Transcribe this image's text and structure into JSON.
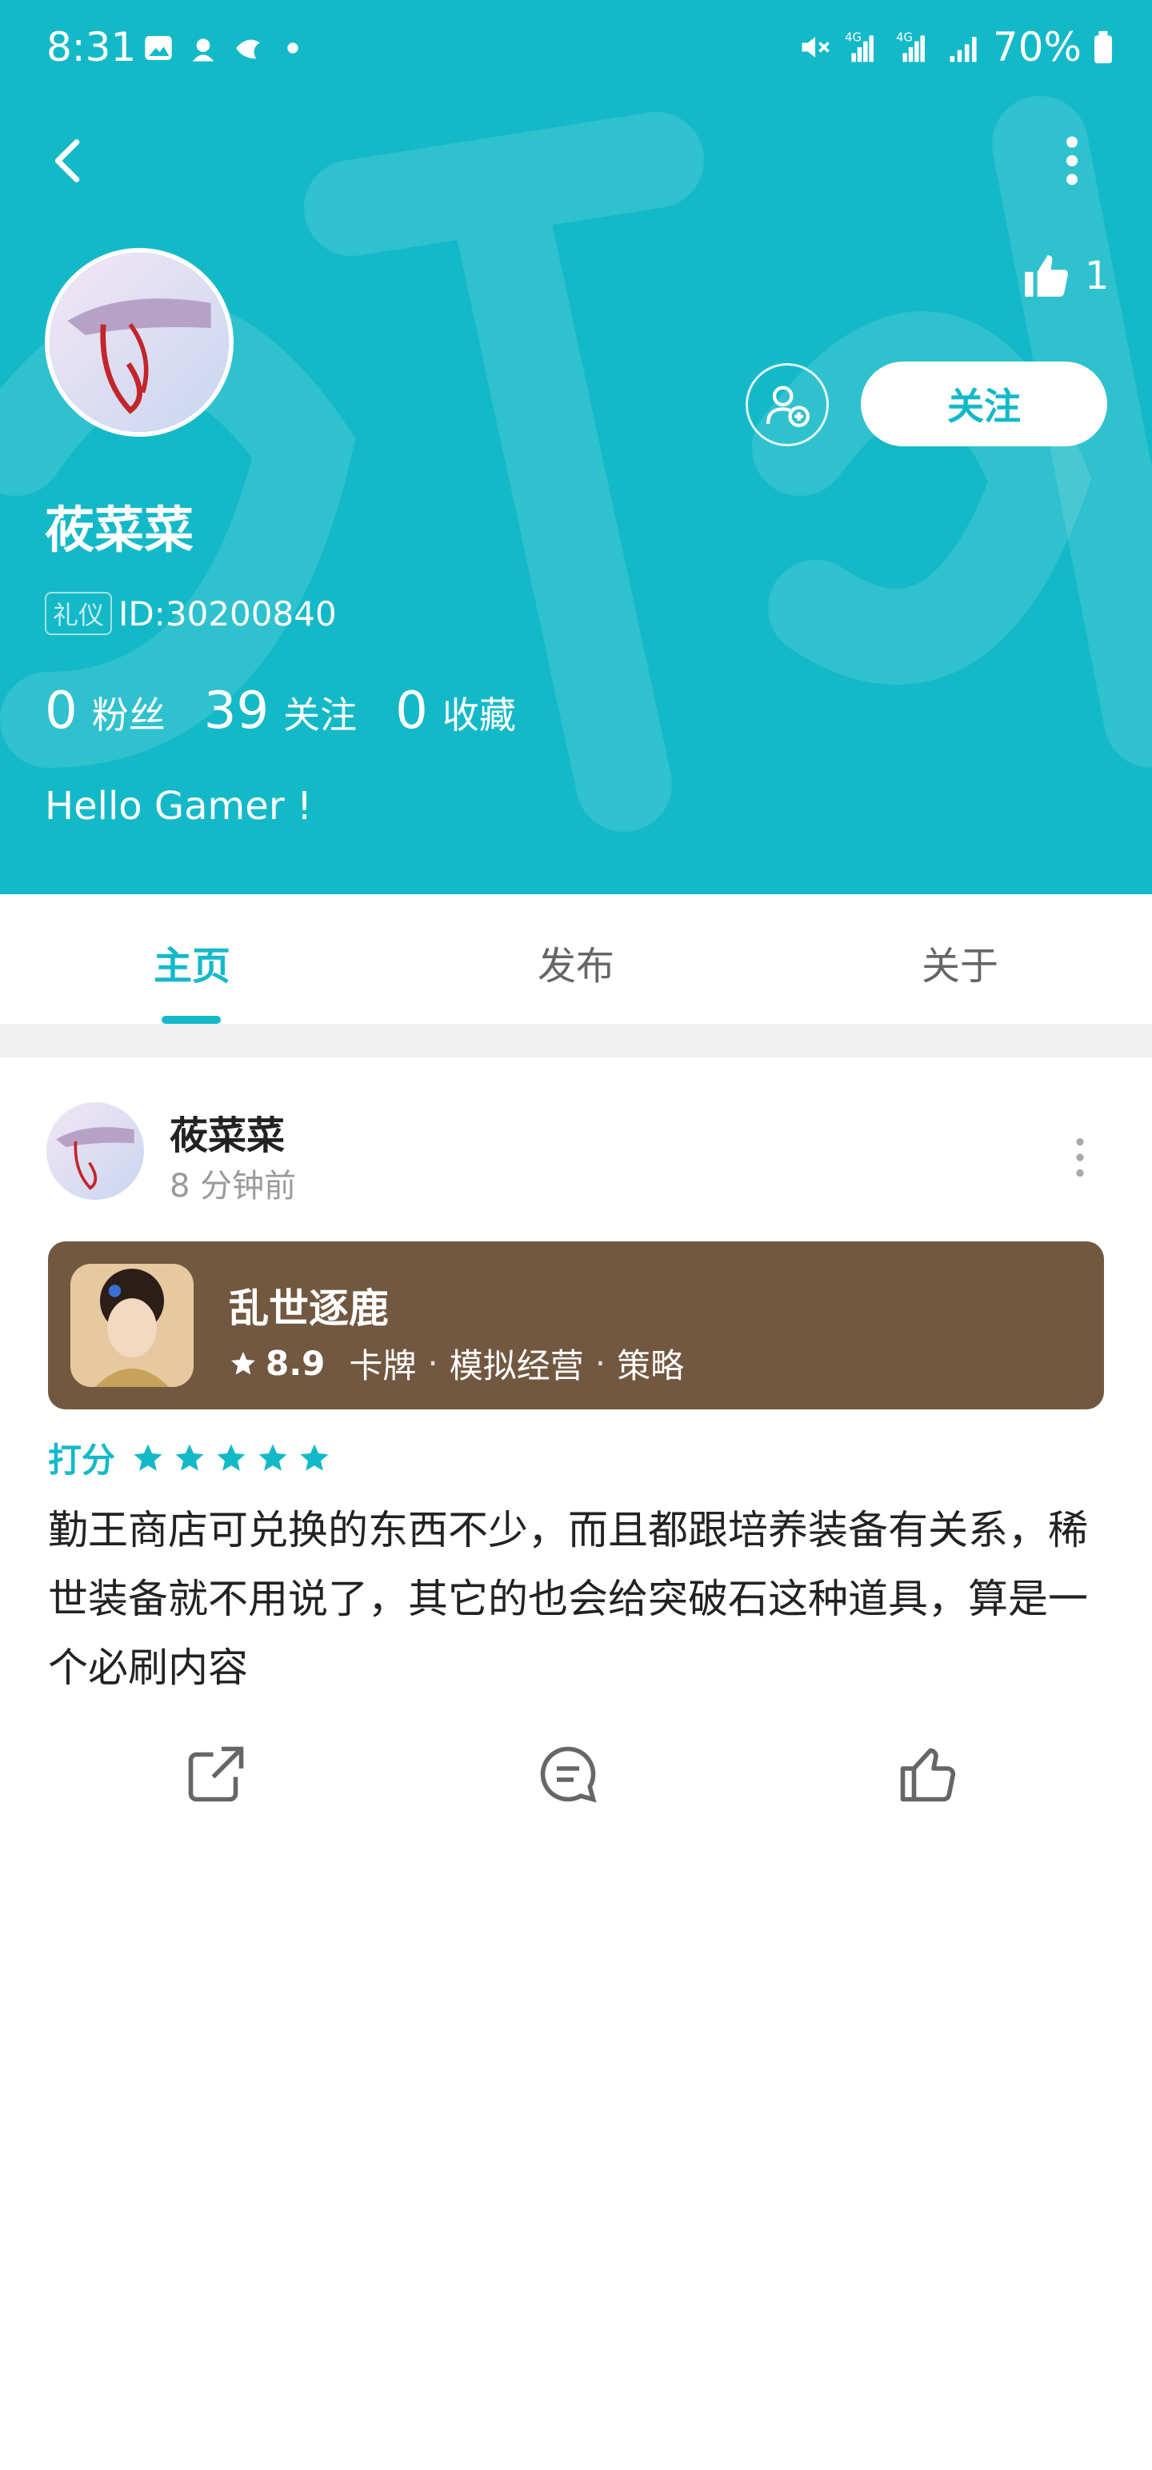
{
  "status_bar": {
    "time": "8:31",
    "battery": "70%",
    "left_icons": [
      "gallery-icon",
      "notification-app-icon",
      "notification-app-icon-2",
      "dot-icon"
    ],
    "right_icons": [
      "mute-icon",
      "4g-signal-icon",
      "4g-signal-icon-2",
      "signal-icon",
      "battery-icon"
    ]
  },
  "colors": {
    "accent": "#14b9c8",
    "card_bg": "#725840"
  },
  "profile": {
    "likes": "1",
    "username": "莜菜菜",
    "tag": "礼仪",
    "id": "ID:30200840",
    "follow_label": "关注",
    "stats": [
      {
        "num": "0",
        "label": "粉丝"
      },
      {
        "num": "39",
        "label": "关注"
      },
      {
        "num": "0",
        "label": "收藏"
      }
    ],
    "bio": "Hello Gamer !"
  },
  "tabs": [
    "主页",
    "发布",
    "关于"
  ],
  "active_tab": 0,
  "post": {
    "author": "莜菜菜",
    "time": "8 分钟前",
    "game": {
      "name": "乱世逐鹿",
      "rating": "8.9",
      "tags": [
        "卡牌",
        "模拟经营",
        "策略"
      ]
    },
    "score_label": "打分",
    "stars": 5,
    "text": "勤王商店可兑换的东西不少，而且都跟培养装备有关系，稀世装备就不用说了，其它的也会给突破石这种道具，算是一个必刷内容"
  }
}
